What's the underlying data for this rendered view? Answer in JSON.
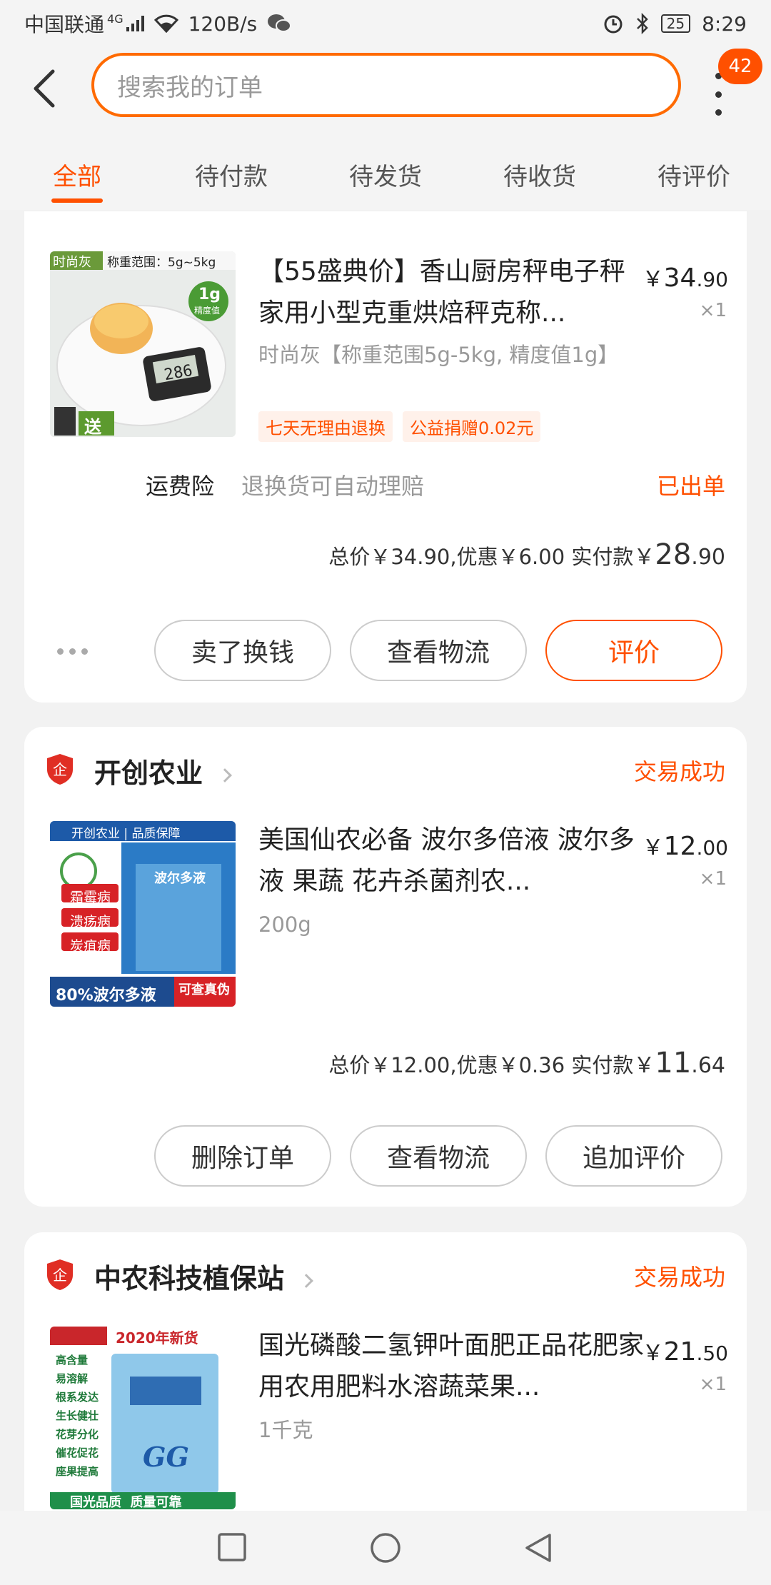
{
  "status_bar": {
    "carrier": "中国联通",
    "network": "4G",
    "speed": "120B/s",
    "battery": "25",
    "time": "8:29"
  },
  "header": {
    "search_placeholder": "搜索我的订单",
    "badge_count": "42"
  },
  "tabs": [
    {
      "label": "全部",
      "active": true
    },
    {
      "label": "待付款"
    },
    {
      "label": "待发货"
    },
    {
      "label": "待收货"
    },
    {
      "label": "待评价"
    }
  ],
  "orders": [
    {
      "item": {
        "title": "【55盛典价】香山厨房秤电子秤家用小型克重烘焙秤克称...",
        "spec": "时尚灰【称重范围5g-5kg, 精度值1g】",
        "price_int": "34",
        "price_dec": ".90",
        "qty": "×1",
        "tags": [
          "七天无理由退换",
          "公益捐赠0.02元"
        ],
        "thumb_text": {
          "color_tag": "时尚灰",
          "range": "称重范围：5g~5kg",
          "accuracy_value": "1g",
          "accuracy_label": "精度值",
          "display": "286",
          "gift": "送"
        }
      },
      "insurance": {
        "label": "运费险",
        "desc": "退换货可自动理赔",
        "status": "已出单"
      },
      "total": {
        "text": "总价￥34.90,优惠￥6.00 实付款",
        "currency": "￥",
        "pay_int": "28",
        "pay_dec": ".90"
      },
      "buttons": [
        "卖了换钱",
        "查看物流",
        "评价"
      ]
    },
    {
      "shop": {
        "name": "开创农业",
        "status": "交易成功"
      },
      "item": {
        "title": "美国仙农必备 波尔多倍液 波尔多液 果蔬 花卉杀菌剂农...",
        "spec": "200g",
        "price_int": "12",
        "price_dec": ".00",
        "qty": "×1",
        "thumb_text": {
          "header": "开创农业 | 品质保障",
          "diseases": [
            "霜霉病",
            "溃疡病",
            "炭疽病"
          ],
          "pack_name": "波尔多液",
          "bottom": "80%波尔多液",
          "verify": "可查真伪"
        }
      },
      "total": {
        "text": "总价￥12.00,优惠￥0.36 实付款",
        "currency": "￥",
        "pay_int": "11",
        "pay_dec": ".64"
      },
      "buttons": [
        "删除订单",
        "查看物流",
        "追加评价"
      ]
    },
    {
      "shop": {
        "name": "中农科技植保站",
        "status": "交易成功"
      },
      "item": {
        "title": "国光磷酸二氢钾叶面肥正品花肥家用农用肥料水溶蔬菜果...",
        "spec": "1千克",
        "price_int": "21",
        "price_dec": ".50",
        "qty": "×1",
        "thumb_text": {
          "header": "2020年新货",
          "features": [
            "高含量",
            "易溶解",
            "根系发达",
            "生长健壮",
            "花芽分化",
            "催花促花",
            "座果提高"
          ],
          "logo": "GG",
          "bottom": "国光品质  质量可靠"
        }
      }
    }
  ],
  "colors": {
    "accent": "#ff5000",
    "background": "#f2f2f2"
  }
}
